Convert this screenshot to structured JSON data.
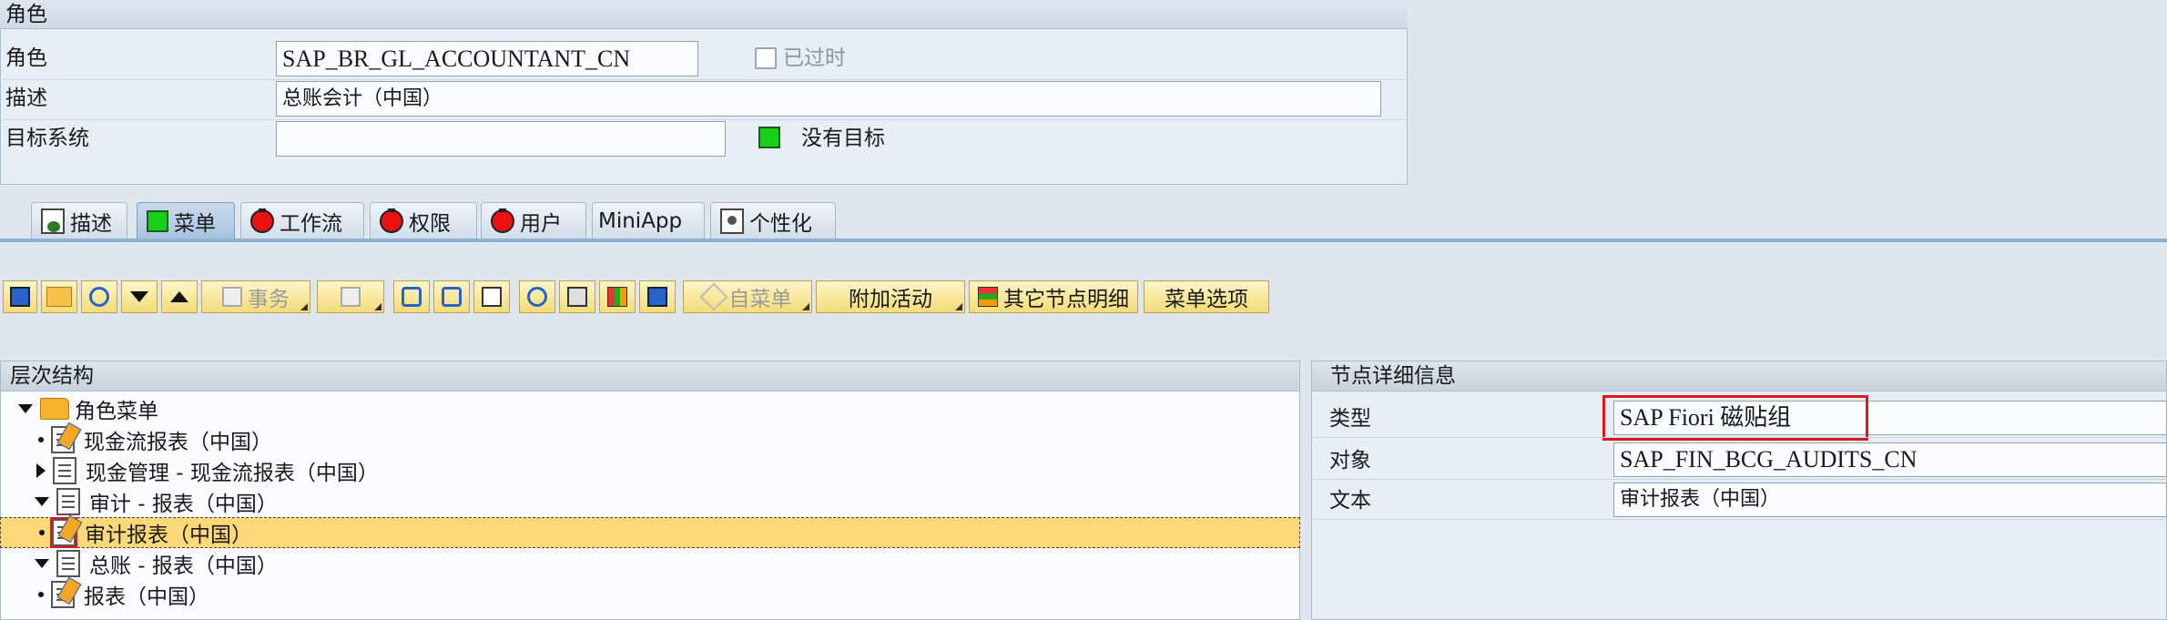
{
  "role_panel": {
    "title": "角色",
    "role_label": "角色",
    "role_value": "SAP_BR_GL_ACCOUNTANT_CN",
    "obsolete_label": "已过时",
    "desc_label": "描述",
    "desc_value": "总账会计（中国）",
    "target_label": "目标系统",
    "target_value": "",
    "no_target_label": "没有目标"
  },
  "tabs": [
    {
      "label": "描述",
      "icon": "document-icon"
    },
    {
      "label": "菜单",
      "icon": "green-status-icon"
    },
    {
      "label": "工作流",
      "icon": "red-status-icon"
    },
    {
      "label": "权限",
      "icon": "red-status-icon"
    },
    {
      "label": "用户",
      "icon": "red-status-icon"
    },
    {
      "label": "MiniApp",
      "icon": ""
    },
    {
      "label": "个性化",
      "icon": "personalize-icon"
    }
  ],
  "toolbar": {
    "transaction_label": "事务",
    "submenu_label": "自菜单",
    "additional_activities_label": "附加活动",
    "other_node_details_label": "其它节点明细",
    "menu_options_label": "菜单选项"
  },
  "hierarchy": {
    "title": "层次结构",
    "items": [
      {
        "label": "角色菜单",
        "level": 0,
        "expander": "expanded",
        "icon": "folder-open-icon"
      },
      {
        "label": "现金流报表（中国）",
        "level": 1,
        "expander": "none",
        "icon": "fiori-tile-icon"
      },
      {
        "label": "现金管理 - 现金流报表（中国）",
        "level": 1,
        "expander": "collapsed",
        "icon": "list-icon"
      },
      {
        "label": "审计 - 报表（中国）",
        "level": 1,
        "expander": "expanded",
        "icon": "list-icon"
      },
      {
        "label": "审计报表（中国）",
        "level": 1,
        "expander": "none",
        "icon": "fiori-tile-icon",
        "selected": true
      },
      {
        "label": "总账 - 报表（中国）",
        "level": 1,
        "expander": "expanded",
        "icon": "list-icon"
      },
      {
        "label": "报表（中国）",
        "level": 1,
        "expander": "none",
        "icon": "fiori-tile-icon"
      }
    ]
  },
  "node_details": {
    "title": "节点详细信息",
    "type_label": "类型",
    "type_value": "SAP Fiori 磁贴组",
    "object_label": "对象",
    "object_value": "SAP_FIN_BCG_AUDITS_CN",
    "text_label": "文本",
    "text_value": "审计报表（中国）"
  },
  "colors": {
    "highlight": "#e0161e",
    "selection": "#ffd87a",
    "toolbar": "#f3dc78"
  }
}
